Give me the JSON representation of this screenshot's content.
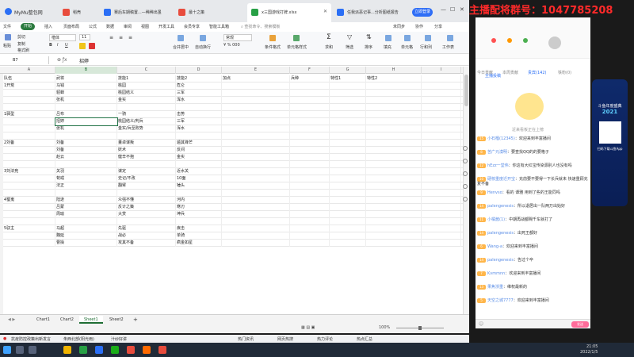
{
  "browser": {
    "app_name": "MyMu整包网",
    "tabs": [
      {
        "label": "稻壳",
        "color": "#e84c3d"
      },
      {
        "label": "赛后车期稿置...—稀稀出虽",
        "color": "#2b6ff5"
      },
      {
        "label": "最十之策",
        "color": "#e84c3d"
      },
      {
        "label": "x三国游戏打牌.xlsx",
        "color": "#27a045"
      },
      {
        "label": "任我派恶记事...分析图纸报告",
        "color": "#2b6ff5"
      }
    ],
    "login_label": "立即登录"
  },
  "menu": {
    "items": [
      "文件",
      "开始",
      "插入",
      "页面布局",
      "公式",
      "数据",
      "审阅",
      "视图",
      "开发工具",
      "会员专享",
      "智能工具箱"
    ],
    "active_index": 1,
    "search_placeholder": "查找命令、搜索模板",
    "right_items": [
      "未同步",
      "协作",
      "分享"
    ]
  },
  "ribbon": {
    "paste": "粘贴",
    "cut": "剪切",
    "copy": "复制",
    "format_painter": "格式刷",
    "font_name": "楷体",
    "font_size": "11",
    "merge": "合并居中",
    "wrap": "自动换行",
    "number_format": "常规",
    "conditional": "条件格式",
    "cell_style": "单元格样式",
    "sum": "求和",
    "filter": "筛选",
    "sort": "排序",
    "fill": "填充",
    "cell": "单元格",
    "row_col": "行和列",
    "sheet": "工作表"
  },
  "formula": {
    "name_box": "B7",
    "content": "招婷"
  },
  "columns": [
    "A",
    "B",
    "C",
    "D",
    "E",
    "F",
    "G",
    "H",
    "I"
  ],
  "selected_column": "B",
  "rows": [
    [
      "队伍",
      "武将",
      "技能1",
      "技能2",
      "加点",
      "兵种",
      "特性1",
      "特性2",
      ""
    ],
    [
      "1开荒",
      "马钱",
      "桃园",
      "危仑",
      "",
      "",
      "",
      "",
      ""
    ],
    [
      "",
      "貂蝉",
      "桃园结义",
      "三军",
      "",
      "",
      "",
      "",
      ""
    ],
    [
      "",
      "张机",
      "金实",
      "浑水",
      "",
      "",
      "",
      "",
      ""
    ],
    [
      "",
      "",
      "",
      "",
      "",
      "",
      "",
      "",
      ""
    ],
    [
      "1驿型",
      "吕布",
      "一骑",
      "击势",
      "",
      "",
      "",
      "",
      ""
    ],
    [
      "",
      "招婷",
      "桃园结义/判兵",
      "三军",
      "",
      "",
      "",
      "",
      ""
    ],
    [
      "",
      "张机",
      "金实/兵至败势",
      "浑水",
      "",
      "",
      "",
      "",
      ""
    ],
    [
      "",
      "",
      "",
      "",
      "",
      "",
      "",
      "",
      ""
    ],
    [
      "2刘备",
      "刘备",
      "董卓谋叛",
      "遁其锋芒",
      "",
      "",
      "",
      "",
      ""
    ],
    [
      "",
      "刘备",
      "妖术",
      "反间",
      "",
      "",
      "",
      "",
      ""
    ],
    [
      "",
      "赵云",
      "健辛不抱",
      "金实",
      "",
      "",
      "",
      "",
      ""
    ],
    [
      "",
      "",
      "",
      "",
      "",
      "",
      "",
      "",
      ""
    ],
    [
      "3刘法竞",
      "关羽",
      "谋定",
      "近水关",
      "",
      "",
      "",
      "",
      ""
    ],
    [
      "",
      "荀彧",
      "史记/不改",
      "10面",
      "",
      "",
      "",
      "",
      ""
    ],
    [
      "",
      "法正",
      "翻臂",
      "锤头",
      "",
      "",
      "",
      "",
      ""
    ],
    [
      "",
      "",
      "",
      "",
      "",
      "",
      "",
      "",
      ""
    ],
    [
      "4蜀嵬",
      "陆逊",
      "众强不懂",
      "河内",
      "",
      "",
      "",
      "",
      ""
    ],
    [
      "",
      "吕蒙",
      "反计之策",
      "寒刃",
      "",
      "",
      "",
      "",
      ""
    ],
    [
      "",
      "周瑜",
      "大赏",
      "坤兵",
      "",
      "",
      "",
      "",
      ""
    ],
    [
      "",
      "",
      "",
      "",
      "",
      "",
      "",
      "",
      ""
    ],
    [
      "5驭主",
      "马超",
      "先驱",
      "疾击",
      "",
      "",
      "",
      "",
      ""
    ],
    [
      "",
      "魏延",
      "战必",
      "单骑",
      "",
      "",
      "",
      "",
      ""
    ],
    [
      "",
      "曹操",
      "攻其不备",
      "疯金如星",
      "",
      "",
      "",
      "",
      ""
    ]
  ],
  "active_cell": {
    "row": 6,
    "col": 1
  },
  "sheet_tabs": [
    "Chart1",
    "Chart2",
    "Sheet1",
    "Sheet2"
  ],
  "active_sheet": "Sheet1",
  "status": {
    "zoom": "100%"
  },
  "news_bar": {
    "items": [
      "抗疫防控政策出新发言",
      "朱西北部(阳光雨)",
      "汁纱好讲",
      "热门资讯",
      "网页热搜",
      "热力评论",
      "热点汇总"
    ]
  },
  "taskbar": {
    "time": "21:05",
    "date": "2022/1/5"
  },
  "stream": {
    "banner": "主播配将群号：1047785208",
    "anchor_tip": "主播投稿",
    "tabs": [
      "今日贡献",
      "本周贡献",
      "贵宾(142)",
      "铁粉(0)"
    ],
    "active_tab_index": 2,
    "empty_rank_text": "近来看板正在上榜",
    "chat": [
      {
        "name": "小石榴(12345)",
        "text": "欢迎来到丰富播间",
        "level": "15"
      },
      {
        "name": "苦广元漠明",
        "text": "要查找QQ的的要格子",
        "level": "8"
      },
      {
        "name": "hEzz一堂伟",
        "text": "你这有大红宝传染源别人也没有吗",
        "level": "12"
      },
      {
        "name": "硬核重度迁开宝",
        "text": "充前要不要得一下长兵就未 快速重顾充复不备",
        "level": "10"
      },
      {
        "name": "Henvso",
        "text": "看的 谭雅 用到了些的王能同吗",
        "level": "9"
      },
      {
        "name": "palengenesis",
        "text": "所以退居出一队两万出始好",
        "level": "14"
      },
      {
        "name": "小橘酱(1)",
        "text": "中期再战都赐千车就打了",
        "level": "11"
      },
      {
        "name": "palengenesis",
        "text": "出死王都好",
        "level": "14"
      },
      {
        "name": "Wang-a",
        "text": "欢迎来到丰富播间",
        "level": "6"
      },
      {
        "name": "palengenesis",
        "text": "告过个卒",
        "level": "14"
      },
      {
        "name": "Kvmmnn",
        "text": "欢迎来到丰富播间",
        "level": "7"
      },
      {
        "name": "果焦浙重",
        "text": "维权最新的",
        "level": "13"
      },
      {
        "name": "天空之城7777",
        "text": "欢迎来到丰富播间",
        "level": "5"
      }
    ],
    "send_label": "发送",
    "promo": {
      "title": "斗鱼年度盛典",
      "year": "2021",
      "caption": "扫码下载斗鱼App"
    }
  }
}
